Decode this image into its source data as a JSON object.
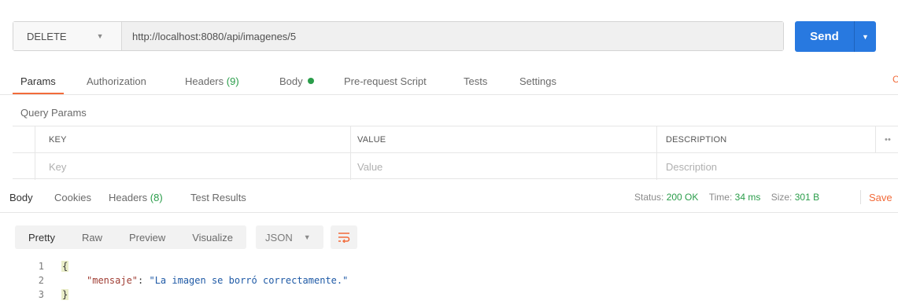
{
  "request": {
    "method": "DELETE",
    "url": "http://localhost:8080/api/imagenes/5",
    "send_label": "Send"
  },
  "request_tabs": {
    "params": "Params",
    "authorization": "Authorization",
    "headers": "Headers",
    "headers_count": "(9)",
    "body": "Body",
    "prerequest": "Pre-request Script",
    "tests": "Tests",
    "settings": "Settings"
  },
  "query_params": {
    "title": "Query Params",
    "headers": {
      "key": "KEY",
      "value": "VALUE",
      "description": "DESCRIPTION",
      "more": "••"
    },
    "placeholders": {
      "key": "Key",
      "value": "Value",
      "description": "Description"
    }
  },
  "response_tabs": {
    "body": "Body",
    "cookies": "Cookies",
    "headers": "Headers",
    "headers_count": "(8)",
    "test_results": "Test Results"
  },
  "status": {
    "status_label": "Status:",
    "status_value": "200 OK",
    "time_label": "Time:",
    "time_value": "34 ms",
    "size_label": "Size:",
    "size_value": "301 B",
    "save": "Save"
  },
  "view_toolbar": {
    "pretty": "Pretty",
    "raw": "Raw",
    "preview": "Preview",
    "visualize": "Visualize",
    "format": "JSON"
  },
  "code": {
    "line_numbers": [
      "1",
      "2",
      "3"
    ],
    "open_brace": "{",
    "key": "\"mensaje\"",
    "colon": ": ",
    "value": "\"La imagen se borró correctamente.\"",
    "close_brace": "}"
  },
  "colors": {
    "accent_orange": "#f26b3a",
    "send_blue": "#2879e0",
    "success_green": "#2a9d4a"
  },
  "icons": [
    "caret-down-icon",
    "status-dot-icon",
    "wrap-lines-icon"
  ]
}
